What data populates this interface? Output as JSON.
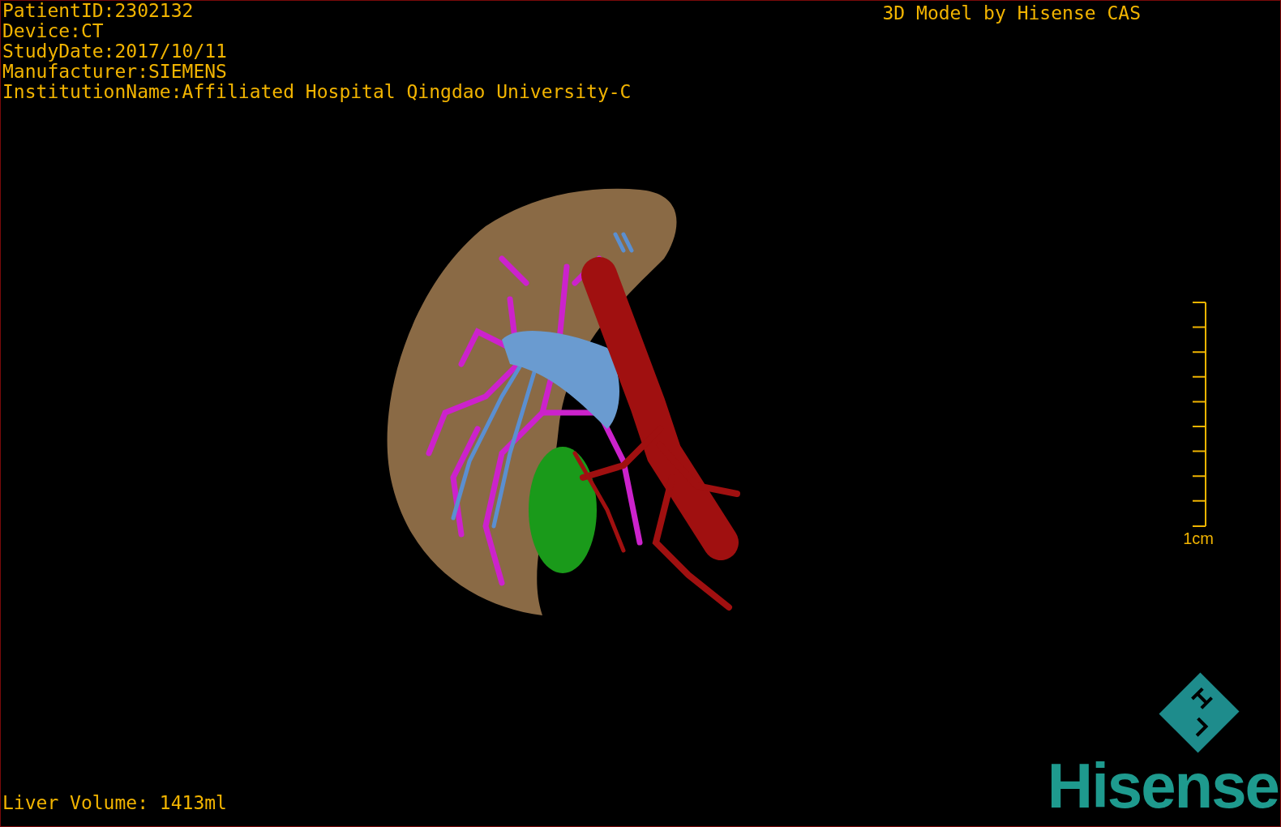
{
  "info_lines": [
    "PatientID:2302132",
    "Device:CT",
    "StudyDate:2017/10/11",
    "Manufacturer:SIEMENS",
    "InstitutionName:Affiliated Hospital Qingdao University-C"
  ],
  "title": "3D Model by Hisense CAS",
  "scale_bar": {
    "label": "1cm"
  },
  "liver_volume": "Liver Volume: 1413ml",
  "logo": {
    "text": "Hisense"
  }
}
